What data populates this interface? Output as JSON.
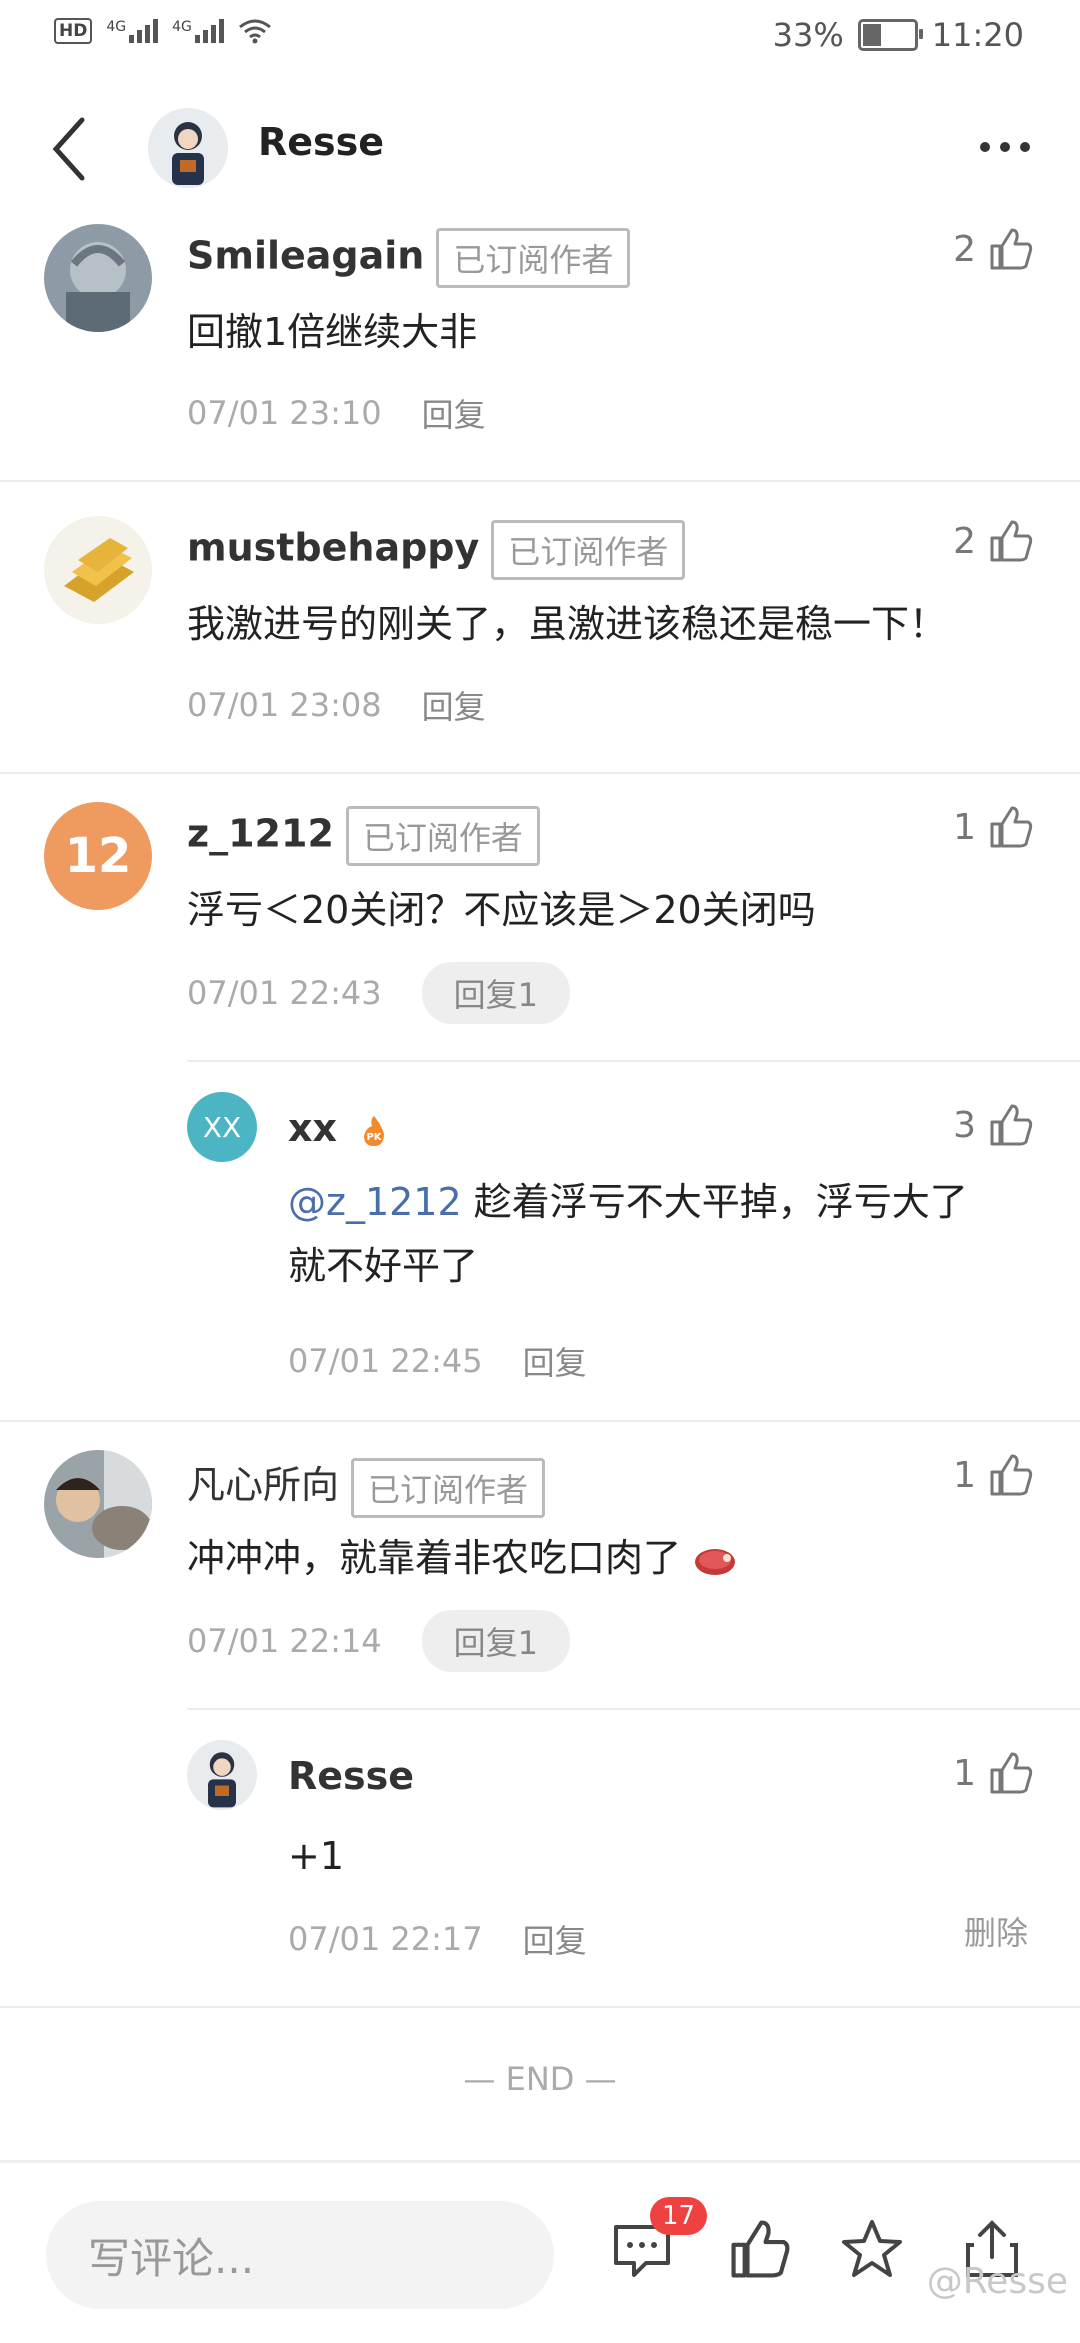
{
  "status": {
    "battery": "33%",
    "time": "11:20",
    "hd": "HD",
    "net1": "4G",
    "net2": "4G"
  },
  "header": {
    "title": "Resse"
  },
  "badge": "已订阅作者",
  "comments": [
    {
      "name": "Smileagain",
      "likes": "2",
      "text": "回撤1倍继续大非",
      "time": "07/01 23:10",
      "reply": "回复"
    },
    {
      "name": "mustbehappy",
      "likes": "2",
      "text": "我激进号的刚关了，虽激进该稳还是稳一下！",
      "time": "07/01 23:08",
      "reply": "回复"
    },
    {
      "name": "z_1212",
      "avatar_text": "12",
      "likes": "1",
      "text": "浮亏＜20关闭？不应该是＞20关闭吗",
      "time": "07/01 22:43",
      "reply": "回复1",
      "sub": {
        "name": "xx",
        "avatar_text": "XX",
        "likes": "3",
        "mention": "@z_1212",
        "text_line1": " 趁着浮亏不大平掉，浮亏大了",
        "text_line2": "就不好平了",
        "time": "07/01 22:45",
        "reply": "回复"
      }
    },
    {
      "name": "凡心所向",
      "likes": "1",
      "text": "冲冲冲，就靠着非农吃口肉了",
      "time": "07/01 22:14",
      "reply": "回复1",
      "sub": {
        "name": "Resse",
        "likes": "1",
        "text": "+1",
        "time": "07/01 22:17",
        "reply": "回复",
        "delete": "删除"
      }
    }
  ],
  "end": "— END —",
  "bottom": {
    "placeholder": "写评论...",
    "comment_count": "17"
  },
  "watermark": "@Resse"
}
